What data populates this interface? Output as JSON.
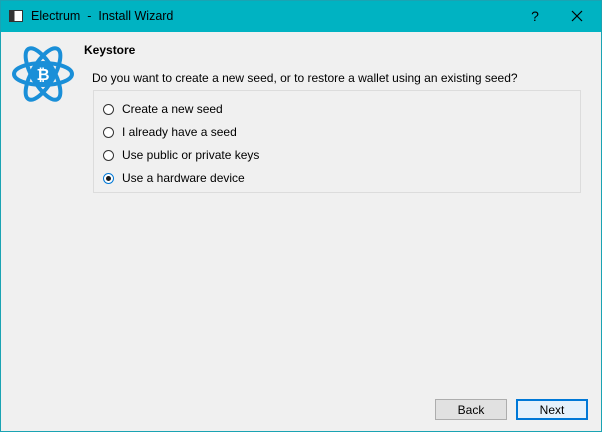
{
  "window": {
    "title": "Electrum  -  Install Wizard",
    "help_label": "?",
    "icons": {
      "app": "window-icon",
      "close": "close-icon",
      "logo": "electrum-logo-icon"
    },
    "accent_color": "#00b3c2"
  },
  "page": {
    "section_title": "Keystore",
    "question": "Do you want to create a new seed, or to restore a wallet using an existing seed?",
    "options": [
      {
        "label": "Create a new seed",
        "checked": false
      },
      {
        "label": "I already have a seed",
        "checked": false
      },
      {
        "label": "Use public or private keys",
        "checked": false
      },
      {
        "label": "Use a hardware device",
        "checked": true
      }
    ]
  },
  "footer": {
    "back_label": "Back",
    "next_label": "Next"
  }
}
